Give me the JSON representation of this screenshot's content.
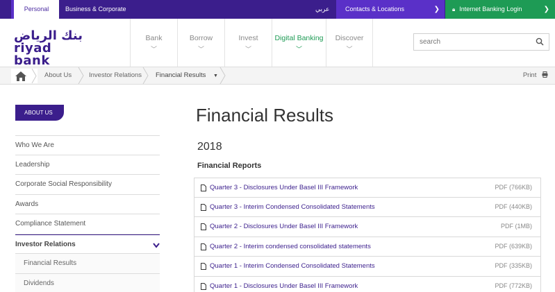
{
  "topbar": {
    "personal": "Personal",
    "business": "Business & Corporate",
    "arabic": "عربي",
    "contacts": "Contacts & Locations",
    "login": "Internet Banking Login"
  },
  "header": {
    "logo_ar": "بنك الرياض",
    "logo_en": "riyad bank",
    "nav": [
      "Bank",
      "Borrow",
      "Invest",
      "Digital Banking",
      "Discover"
    ],
    "search_placeholder": "search"
  },
  "breadcrumb": {
    "items": [
      "About Us",
      "Investor Relations",
      "Financial Results"
    ],
    "print": "Print"
  },
  "sidebar": {
    "section": "ABOUT US",
    "items": [
      "Who We Are",
      "Leadership",
      "Corporate Social Responsibility",
      "Awards",
      "Compliance Statement",
      "Investor Relations",
      "Financial Results",
      "Dividends"
    ]
  },
  "main": {
    "title": "Financial Results",
    "year": "2018",
    "reports_heading": "Financial Reports",
    "reports": [
      {
        "label": "Quarter 3 - Disclosures Under Basel III Framework",
        "size": "PDF (766KB)"
      },
      {
        "label": "Quarter 3 - Interim Condensed Consolidated Statements",
        "size": "PDF (440KB)"
      },
      {
        "label": "Quarter 2 - Disclosures Under Basel III Framework",
        "size": "PDF (1MB)"
      },
      {
        "label": "Quarter 2 - Interim condensed consolidated statements",
        "size": "PDF (639KB)"
      },
      {
        "label": "Quarter 1 - Interim Condensed Consolidated Statements",
        "size": "PDF (335KB)"
      },
      {
        "label": "Quarter 1 - Disclosures Under Basel III Framework",
        "size": "PDF (772KB)"
      }
    ]
  },
  "colors": {
    "brand_purple": "#3b1e8c",
    "accent_purple": "#5a30c8",
    "green": "#1e9b55"
  }
}
